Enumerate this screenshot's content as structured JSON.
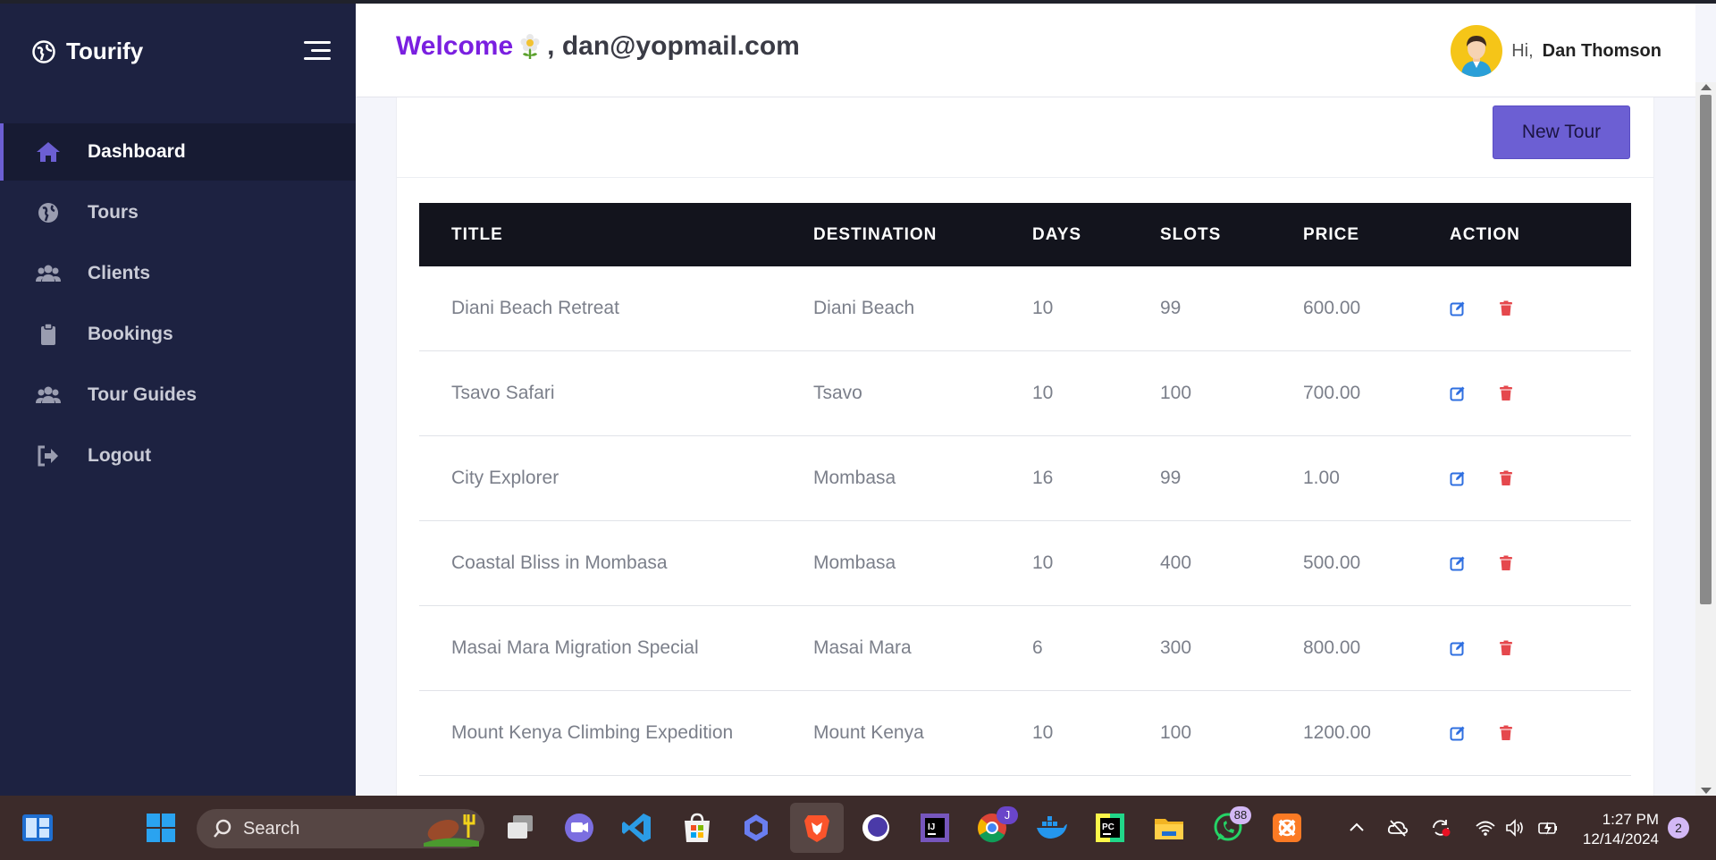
{
  "app": {
    "brand": "Tourify"
  },
  "sidebar": {
    "items": [
      {
        "label": "Dashboard",
        "icon": "home-icon"
      },
      {
        "label": "Tours",
        "icon": "globe-icon"
      },
      {
        "label": "Clients",
        "icon": "users-icon"
      },
      {
        "label": "Bookings",
        "icon": "clipboard-icon"
      },
      {
        "label": "Tour Guides",
        "icon": "users-icon"
      },
      {
        "label": "Logout",
        "icon": "logout-icon"
      }
    ]
  },
  "header": {
    "welcome": "Welcome",
    "email": ", dan@yopmail.com",
    "greeting": "Hi,",
    "user_name": "Dan Thomson"
  },
  "toolbar": {
    "new_tour_label": "New Tour"
  },
  "table": {
    "columns": [
      "TITLE",
      "DESTINATION",
      "DAYS",
      "SLOTS",
      "PRICE",
      "ACTION"
    ],
    "rows": [
      {
        "title": "Diani Beach Retreat",
        "destination": "Diani Beach",
        "days": "10",
        "slots": "99",
        "price": "600.00"
      },
      {
        "title": "Tsavo Safari",
        "destination": "Tsavo",
        "days": "10",
        "slots": "100",
        "price": "700.00"
      },
      {
        "title": "City Explorer",
        "destination": "Mombasa",
        "days": "16",
        "slots": "99",
        "price": "1.00"
      },
      {
        "title": "Coastal Bliss in Mombasa",
        "destination": "Mombasa",
        "days": "10",
        "slots": "400",
        "price": "500.00"
      },
      {
        "title": "Masai Mara Migration Special",
        "destination": "Masai Mara",
        "days": "6",
        "slots": "300",
        "price": "800.00"
      },
      {
        "title": "Mount Kenya Climbing Expedition",
        "destination": "Mount Kenya",
        "days": "10",
        "slots": "100",
        "price": "1200.00"
      }
    ]
  },
  "taskbar": {
    "search_label": "Search",
    "time": "1:27 PM",
    "date": "12/14/2024",
    "whatsapp_badge": "88",
    "chrome_badge": "J",
    "notification_count": "2"
  },
  "colors": {
    "sidebar_bg": "#1d2241",
    "accent": "#6c5fd3",
    "welcome": "#7a1fe0",
    "table_header_bg": "#13141d",
    "edit_icon": "#2f6fe0",
    "delete_icon": "#e5484d"
  }
}
